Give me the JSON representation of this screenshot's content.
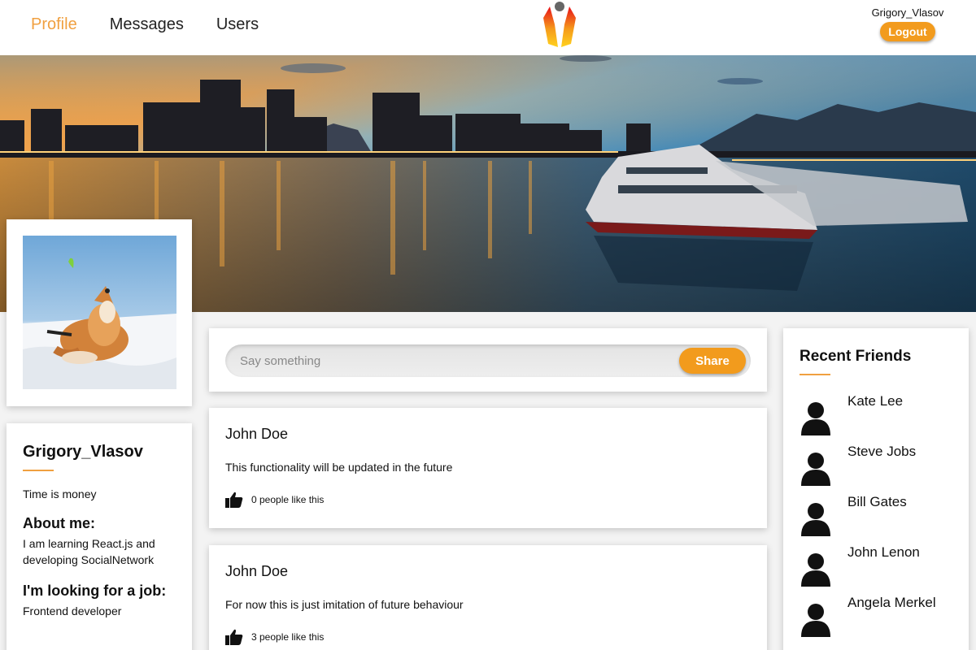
{
  "header": {
    "nav": [
      {
        "label": "Profile",
        "active": true
      },
      {
        "label": "Messages",
        "active": false
      },
      {
        "label": "Users",
        "active": false
      }
    ],
    "username": "Grigory_Vlasov",
    "logout_label": "Logout"
  },
  "profile": {
    "name": "Grigory_Vlasov",
    "status": "Time is money",
    "about_heading": "About me:",
    "about_text": "I am learning React.js and developing SocialNetwork",
    "job_heading": "I'm looking for a job:",
    "job_text": "Frontend developer"
  },
  "post_form": {
    "placeholder": "Say something",
    "share_label": "Share"
  },
  "posts": [
    {
      "author": "John Doe",
      "text": "This functionality will be updated in the future",
      "likes": "0 people like this"
    },
    {
      "author": "John Doe",
      "text": "For now this is just imitation of future behaviour",
      "likes": "3 people like this"
    }
  ],
  "friends": {
    "title": "Recent Friends",
    "items": [
      {
        "name": "Kate Lee"
      },
      {
        "name": "Steve Jobs"
      },
      {
        "name": "Bill Gates"
      },
      {
        "name": "John Lenon"
      },
      {
        "name": "Angela Merkel"
      }
    ]
  },
  "colors": {
    "accent": "#f29b1d",
    "accent_text": "#f0a040"
  },
  "icons": {
    "like": "thumbs-up-icon",
    "friend_avatar": "user-silhouette-icon",
    "logo": "app-logo"
  }
}
